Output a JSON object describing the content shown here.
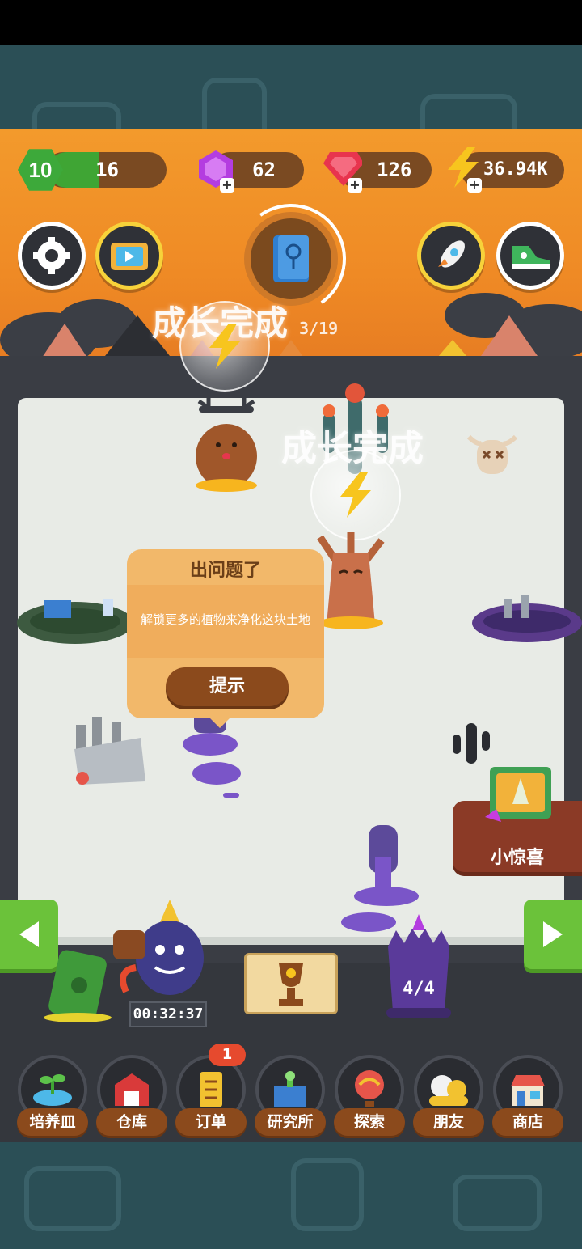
{
  "colors": {
    "sky": "#f39a2c",
    "ground": "#3a3d44",
    "accent_brown": "#8b4a1c",
    "green": "#6bc23a"
  },
  "resources": {
    "level": "10",
    "level_value": "16",
    "purple_gems": "62",
    "red_gems": "126",
    "energy": "36.94K"
  },
  "top_buttons": {
    "settings_icon": "gear-icon",
    "video_icon": "tv-video-icon",
    "book_icon": "plant-book-icon",
    "rocket_icon": "rocket-icon",
    "shoe_icon": "sneaker-icon"
  },
  "plant_count": "3/19",
  "growth_text_1": "成长完成",
  "growth_text_2": "成长完成",
  "popup": {
    "title": "出问题了",
    "message": "解锁更多的植物来净化这块土地",
    "button": "提示"
  },
  "surprise_label": "小惊喜",
  "timer": "00:32:37",
  "crystal_counter": "4/4",
  "nav": [
    {
      "label": "培养皿",
      "icon": "sprout-dish-icon"
    },
    {
      "label": "仓库",
      "icon": "barn-icon"
    },
    {
      "label": "订单",
      "icon": "scroll-order-icon",
      "badge": "1"
    },
    {
      "label": "研究所",
      "icon": "lab-icon"
    },
    {
      "label": "探索",
      "icon": "balloon-icon"
    },
    {
      "label": "朋友",
      "icon": "friends-icon"
    },
    {
      "label": "商店",
      "icon": "shop-icon"
    }
  ]
}
